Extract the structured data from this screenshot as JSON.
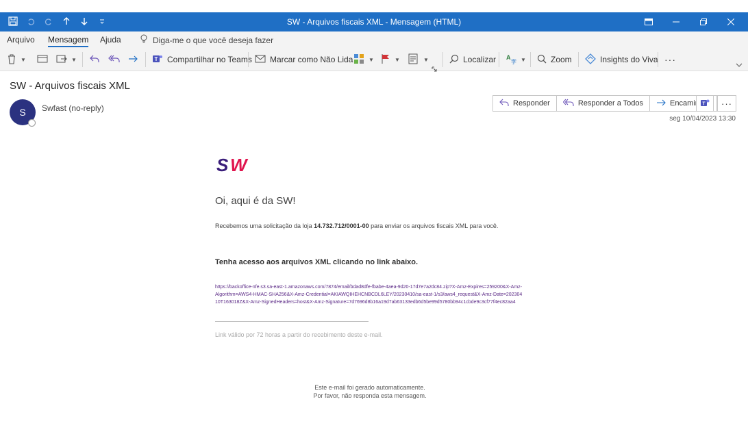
{
  "window": {
    "title": "SW - Arquivos fiscais XML  -  Mensagem (HTML)"
  },
  "menu": {
    "tabs": [
      "Arquivo",
      "Mensagem",
      "Ajuda"
    ],
    "active_tab": "Mensagem",
    "tell_me": "Diga-me o que você deseja fazer"
  },
  "ribbon": {
    "share_teams": "Compartilhar no Teams",
    "mark_unread": "Marcar como Não Lida",
    "find": "Localizar",
    "zoom": "Zoom",
    "insights": "Insights do Viva",
    "more": "···"
  },
  "message": {
    "subject": "SW - Arquivos fiscais XML",
    "avatar_initial": "S",
    "sender": "Swfast (no-reply)",
    "date": "seg 10/04/2023 13:30",
    "actions": {
      "reply": "Responder",
      "reply_all": "Responder a Todos",
      "forward": "Encaminhar"
    },
    "more": "···"
  },
  "email": {
    "logo_text": "SW",
    "greeting": "Oi, aqui é da SW!",
    "intro_prefix": "Recebemos uma solicitação da loja ",
    "store_id": "14.732.712/0001-00",
    "intro_suffix": " para enviar os arquivos fiscais XML para você.",
    "access_heading": "Tenha acesso aos arquivos XML clicando no link abaixo.",
    "link": "https://backoffice-nfe.s3.sa-east-1.amazonaws.com/7874/email/bdad8dfe-fbabe-4aea-9d20-17d7e7a2dc84.zip?X-Amz-Expires=259200&X-Amz-Algorithm=AWS4-HMAC-SHA256&X-Amz-Credential=AKIAWQIHEHCNBCDL6LEY/20230410/sa-east-1/s3/aws4_request&X-Amz-Date=20230410T163018Z&X-Amz-SignedHeaders=host&X-Amz-Signature=7d7696d8b16a19d7ab63133edb6d5be99d5780bb94c1cbde9c3cf77f4ec82aa4",
    "validity": "Link válido por 72 horas a partir do recebimento deste e-mail.",
    "footer_line1": "Este e-mail foi gerado automaticamente.",
    "footer_line2": "Por favor, não responda esta mensagem."
  },
  "colors": {
    "titlebar": "#1f6fc5",
    "avatar": "#2b3280",
    "logo_purple": "#3a1d7a",
    "logo_pink": "#e0154e",
    "link": "#5b2a86"
  }
}
